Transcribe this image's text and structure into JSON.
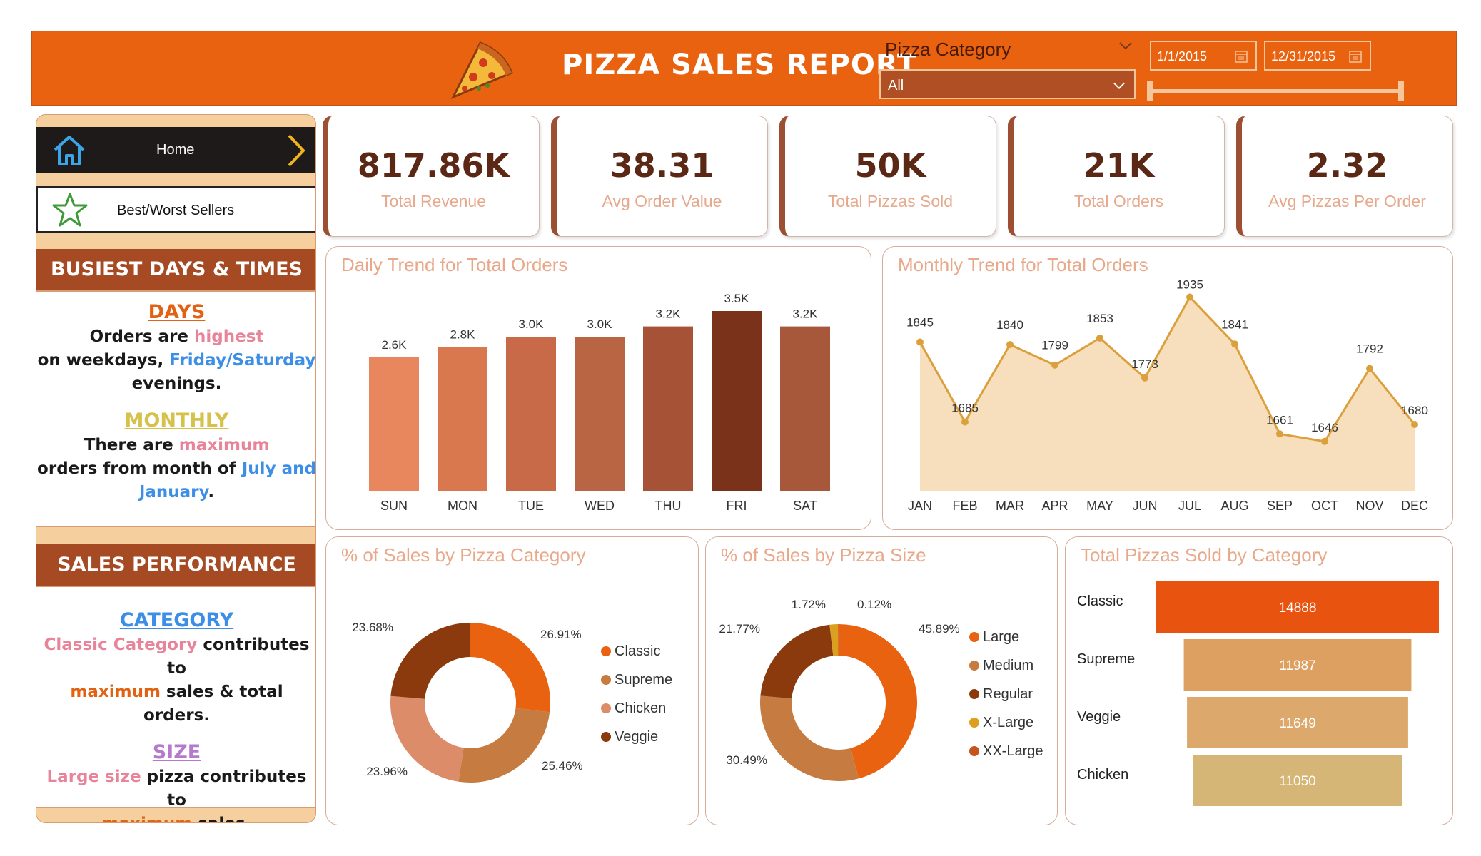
{
  "header": {
    "title": "PIZZA SALES REPORT",
    "filter_label": "Pizza Category",
    "filter_value": "All",
    "date_start": "1/1/2015",
    "date_end": "12/31/2015",
    "accent_color": "#e8620f"
  },
  "nav": {
    "home_label": "Home",
    "best_worst_label": "Best/Worst Sellers"
  },
  "busiest": {
    "heading": "BUSIEST DAYS & TIMES",
    "days_title": "DAYS",
    "days_text": [
      "Orders are ",
      "highest",
      " on weekdays, ",
      "Friday/Saturday",
      " evenings."
    ],
    "monthly_title": "MONTHLY",
    "monthly_text": [
      "There are ",
      "maximum",
      " orders from month of ",
      "July and January",
      "."
    ]
  },
  "sales_perf": {
    "heading": "SALES PERFORMANCE",
    "category_title": "CATEGORY",
    "category_text": [
      "Classic Category",
      " contributes to ",
      "maximum",
      " sales & total orders."
    ],
    "size_title": "SIZE",
    "size_text": [
      "Large size",
      " pizza contributes to ",
      "maximum",
      " sales."
    ]
  },
  "kpis": [
    {
      "value": "817.86K",
      "label": "Total Revenue"
    },
    {
      "value": "38.31",
      "label": "Avg Order Value"
    },
    {
      "value": "50K",
      "label": "Total Pizzas Sold"
    },
    {
      "value": "21K",
      "label": "Total Orders"
    },
    {
      "value": "2.32",
      "label": "Avg Pizzas Per Order"
    }
  ],
  "chart_data": [
    {
      "type": "bar",
      "title": "Daily Trend for Total Orders",
      "categories": [
        "SUN",
        "MON",
        "TUE",
        "WED",
        "THU",
        "FRI",
        "SAT"
      ],
      "values": [
        2.6,
        2.8,
        3.0,
        3.0,
        3.2,
        3.5,
        3.2
      ],
      "data_labels": [
        "2.6K",
        "2.8K",
        "3.0K",
        "3.0K",
        "3.2K",
        "3.5K",
        "3.2K"
      ],
      "colors": [
        "#e8875e",
        "#d9774e",
        "#c86a47",
        "#b96443",
        "#a65236",
        "#7a321b",
        "#a8583a"
      ]
    },
    {
      "type": "area",
      "title": "Monthly Trend for Total Orders",
      "categories": [
        "JAN",
        "FEB",
        "MAR",
        "APR",
        "MAY",
        "JUN",
        "JUL",
        "AUG",
        "SEP",
        "OCT",
        "NOV",
        "DEC"
      ],
      "values": [
        1845,
        1685,
        1840,
        1799,
        1853,
        1773,
        1935,
        1841,
        1661,
        1646,
        1792,
        1680
      ],
      "line_color": "#dba03c",
      "fill_color": "#f7dfbd"
    },
    {
      "type": "pie",
      "title": "% of Sales by Pizza Category",
      "labels": [
        "Classic",
        "Supreme",
        "Chicken",
        "Veggie"
      ],
      "values": [
        26.91,
        25.46,
        23.96,
        23.68
      ],
      "value_labels": [
        "26.91%",
        "25.46%",
        "23.96%",
        "23.68%"
      ],
      "colors": [
        "#e8620f",
        "#c67b40",
        "#dc8c68",
        "#8a3a0d"
      ]
    },
    {
      "type": "pie",
      "title": "% of Sales by Pizza Size",
      "labels": [
        "Large",
        "Medium",
        "Regular",
        "X-Large",
        "XX-Large"
      ],
      "values": [
        45.89,
        30.49,
        21.77,
        1.72,
        0.12
      ],
      "value_labels": [
        "45.89%",
        "30.49%",
        "21.77%",
        "1.72%",
        "0.12%"
      ],
      "colors": [
        "#e8620f",
        "#c67b40",
        "#8a3a0d",
        "#dca021",
        "#c7531d"
      ]
    },
    {
      "type": "bar",
      "title": "Total Pizzas Sold by Category",
      "categories": [
        "Classic",
        "Supreme",
        "Veggie",
        "Chicken"
      ],
      "values": [
        14888,
        11987,
        11649,
        11050
      ],
      "colors": [
        "#e8530f",
        "#dda061",
        "#dda86c",
        "#d6b677"
      ]
    }
  ]
}
